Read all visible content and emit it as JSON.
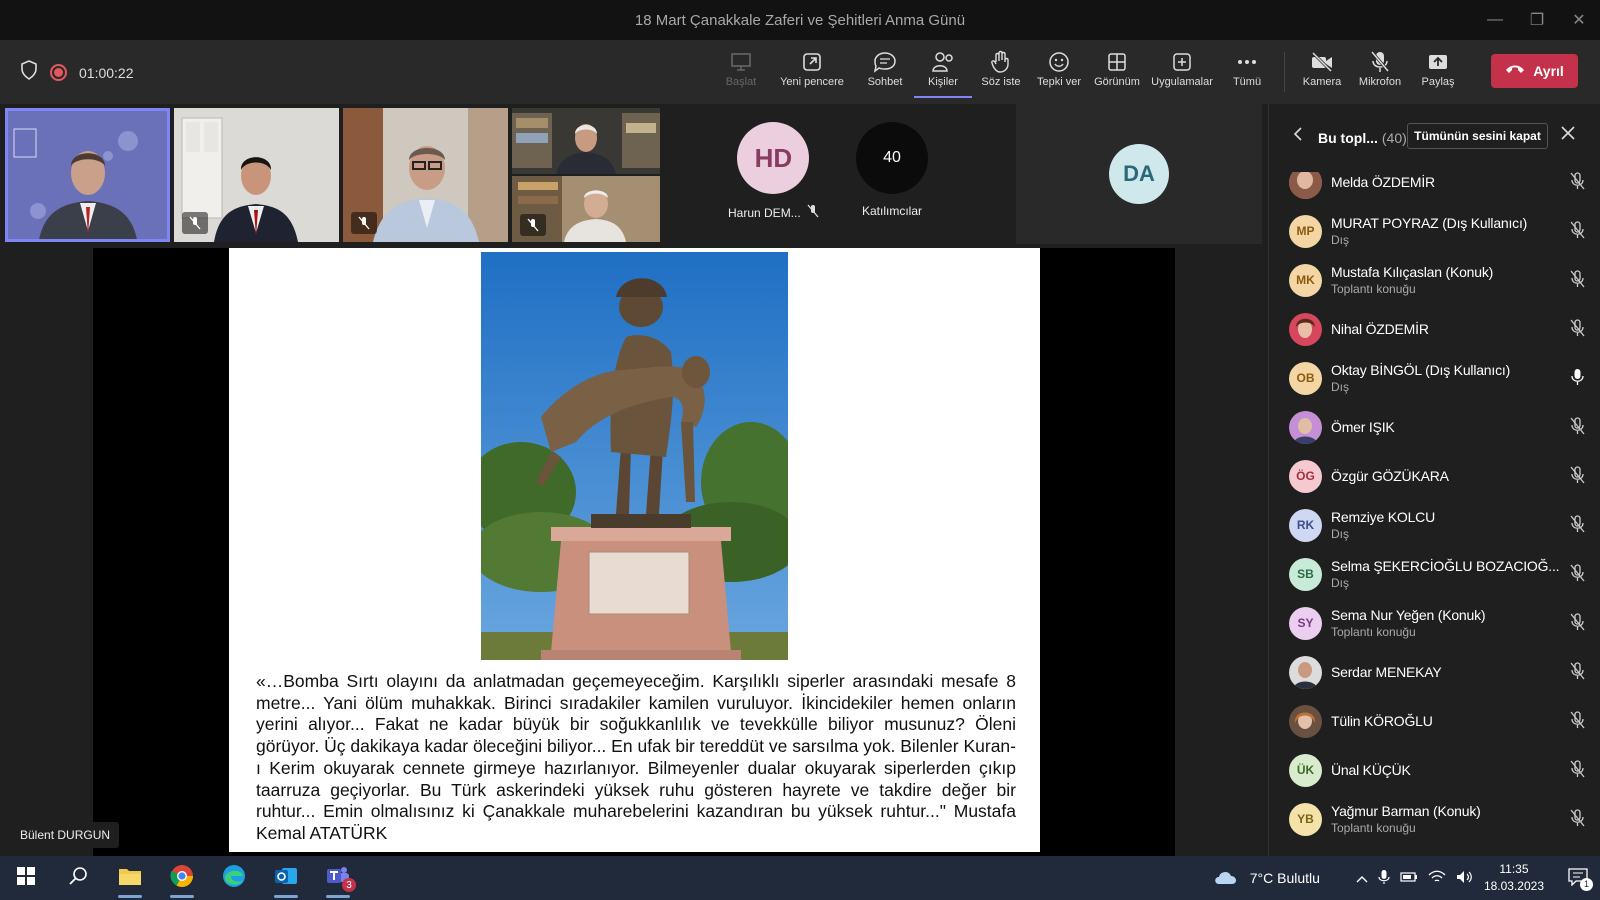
{
  "window": {
    "title": "18 Mart Çanakkale Zaferi ve Şehitleri Anma Günü",
    "controls": [
      "—",
      "❐",
      "✕"
    ]
  },
  "meeting": {
    "timer": "01:00:22"
  },
  "toolbar": {
    "items": [
      {
        "label": "Başlat",
        "icon": "present-icon",
        "disabled": true
      },
      {
        "label": "Yeni pencere",
        "icon": "popout-icon"
      },
      {
        "label": "Sohbet",
        "icon": "chat-icon"
      },
      {
        "label": "Kişiler",
        "icon": "people-icon",
        "active": true
      },
      {
        "label": "Söz iste",
        "icon": "raise-hand-icon"
      },
      {
        "label": "Tepki ver",
        "icon": "reaction-icon"
      },
      {
        "label": "Görünüm",
        "icon": "view-icon"
      },
      {
        "label": "Uygulamalar",
        "icon": "apps-icon"
      },
      {
        "label": "Tümü",
        "icon": "more-icon"
      }
    ],
    "devices": [
      {
        "label": "Kamera",
        "icon": "camera-off-icon"
      },
      {
        "label": "Mikrofon",
        "icon": "mic-off-icon"
      },
      {
        "label": "Paylaş",
        "icon": "share-icon"
      }
    ],
    "leave_label": "Ayrıl"
  },
  "gallery": {
    "harun": {
      "initials": "HD",
      "name": "Harun DEM..."
    },
    "participants_tile": {
      "count": "40",
      "label": "Katılımcılar"
    },
    "da_tile": {
      "initials": "DA"
    }
  },
  "slide": {
    "quote": "«…Bomba Sırtı olayını da anlatmadan geçemeyeceğim. Karşılıklı siperler arasındaki mesafe 8 metre... Yani ölüm muhakkak. Birinci sıradakiler kamilen vuruluyor. İkincidekiler hemen onların yerini alıyor... Fakat ne kadar büyük bir soğukkanlılık ve tevekkülle biliyor musunuz? Öleni görüyor. Üç dakikaya kadar öleceğini biliyor... En ufak bir tereddüt ve sarsılma yok. Bilenler Kuran-ı Kerim okuyarak cennete girmeye hazırlanıyor. Bilmeyenler dualar okuyarak siperlerden çıkıp taarruza geçiyorlar. Bu Türk askerindeki yüksek ruhu gösteren hayrete ve takdire değer bir ruhtur... Emin olmalısınız ki Çanakkale muharebelerini kazandıran bu yüksek ruhtur...\"  Mustafa Kemal ATATÜRK"
  },
  "presenter_name": "Bülent DURGUN",
  "panel": {
    "title": "Bu topl...",
    "count": "(40)",
    "mute_all_label": "Tümünün sesini kapat",
    "participants": [
      {
        "name": "Melda ÖZDEMİR",
        "sub": "",
        "initials": "",
        "photo": true,
        "mic": "off"
      },
      {
        "name": "MURAT POYRAZ (Dış Kullanıcı)",
        "sub": "Dış",
        "initials": "MP",
        "color": "#f3d6a4",
        "text": "#8a5a10",
        "mic": "off"
      },
      {
        "name": "Mustafa Kılıçaslan (Konuk)",
        "sub": "Toplantı konuğu",
        "initials": "MK",
        "color": "#f3d6a4",
        "text": "#8a5a10",
        "mic": "off"
      },
      {
        "name": "Nihal ÖZDEMİR",
        "sub": "",
        "initials": "",
        "photo": true,
        "mic": "off"
      },
      {
        "name": "Oktay BİNGÖL (Dış Kullanıcı)",
        "sub": "Dış",
        "initials": "OB",
        "color": "#f3d6a4",
        "text": "#8a5a10",
        "mic": "on"
      },
      {
        "name": "Ömer IŞIK",
        "sub": "",
        "initials": "",
        "photo": true,
        "mic": "off"
      },
      {
        "name": "Özgür GÖZÜKARA",
        "sub": "",
        "initials": "ÖG",
        "color": "#f4c9cf",
        "text": "#a3303f",
        "mic": "off"
      },
      {
        "name": "Remziye KOLCU",
        "sub": "Dış",
        "initials": "RK",
        "color": "#cfd8f2",
        "text": "#3f4e8c",
        "mic": "off"
      },
      {
        "name": "Selma ŞEKERCİOĞLU BOZACIOĞ...",
        "sub": "Dış",
        "initials": "SB",
        "color": "#c8ead8",
        "text": "#2c6b4a",
        "mic": "off"
      },
      {
        "name": "Sema Nur Yeğen (Konuk)",
        "sub": "Toplantı konuğu",
        "initials": "SY",
        "color": "#eccff0",
        "text": "#7a3b85",
        "mic": "off"
      },
      {
        "name": "Serdar MENEKAY",
        "sub": "",
        "initials": "",
        "photo": true,
        "mic": "off"
      },
      {
        "name": "Tülin KÖROĞLU",
        "sub": "",
        "initials": "",
        "photo": true,
        "mic": "off"
      },
      {
        "name": "Ünal KÜÇÜK",
        "sub": "",
        "initials": "ÜK",
        "color": "#d8eccd",
        "text": "#3f6b2a",
        "mic": "off"
      },
      {
        "name": "Yağmur Barman (Konuk)",
        "sub": "Toplantı konuğu",
        "initials": "YB",
        "color": "#f3e3a8",
        "text": "#7a6310",
        "mic": "off"
      }
    ]
  },
  "taskbar": {
    "weather": "7°C  Bulutlu",
    "time": "11:35",
    "date": "18.03.2023",
    "teams_badge": "3",
    "notif_badge": "1"
  }
}
